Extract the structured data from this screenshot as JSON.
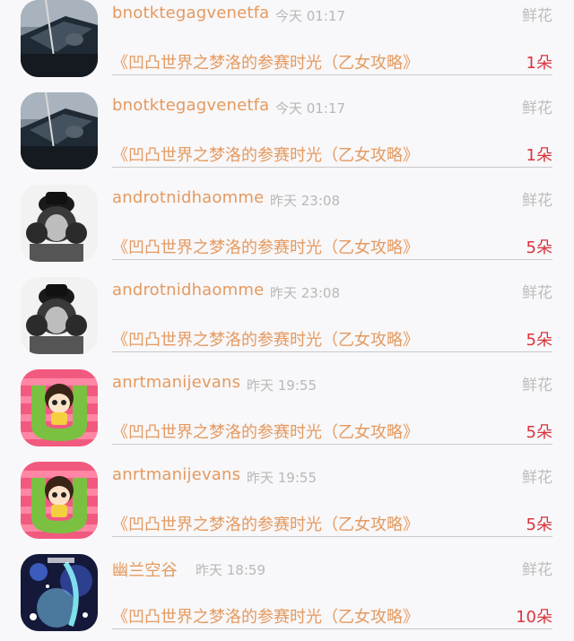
{
  "list": {
    "items": [
      {
        "user": "bnotktegagvenetfa",
        "time": "今天 01:17",
        "gift": "鲜花",
        "book": "《凹凸世界之梦洛的参赛时光（乙女攻略》",
        "count": "1朵",
        "avatar": "car-photo"
      },
      {
        "user": "bnotktegagvenetfa",
        "time": "今天 01:17",
        "gift": "鲜花",
        "book": "《凹凸世界之梦洛的参赛时光（乙女攻略》",
        "count": "1朵",
        "avatar": "car-photo"
      },
      {
        "user": "androtnidhaomme",
        "time": "昨天 23:08",
        "gift": "鲜花",
        "book": "《凹凸世界之梦洛的参赛时光（乙女攻略》",
        "count": "5朵",
        "avatar": "bw-portrait"
      },
      {
        "user": "androtnidhaomme",
        "time": "昨天 23:08",
        "gift": "鲜花",
        "book": "《凹凸世界之梦洛的参赛时光（乙女攻略》",
        "count": "5朵",
        "avatar": "bw-portrait"
      },
      {
        "user": "anrtmanijevans",
        "time": "昨天 19:55",
        "gift": "鲜花",
        "book": "《凹凸世界之梦洛的参赛时光（乙女攻略》",
        "count": "5朵",
        "avatar": "cartoon-girl"
      },
      {
        "user": "anrtmanijevans",
        "time": "昨天 19:55",
        "gift": "鲜花",
        "book": "《凹凸世界之梦洛的参赛时光（乙女攻略》",
        "count": "5朵",
        "avatar": "cartoon-girl"
      },
      {
        "user": "幽兰空谷",
        "time": "昨天 18:59",
        "gift": "鲜花",
        "book": "《凹凸世界之梦洛的参赛时光（乙女攻略》",
        "count": "10朵",
        "avatar": "anime-art"
      }
    ]
  },
  "colors": {
    "username": "#e49a5f",
    "book_title": "#e49a5f",
    "count": "#d9343e",
    "timestamp": "#b8b8b8",
    "gift_label": "#bdbdbd",
    "background": "#f8f7f9"
  }
}
